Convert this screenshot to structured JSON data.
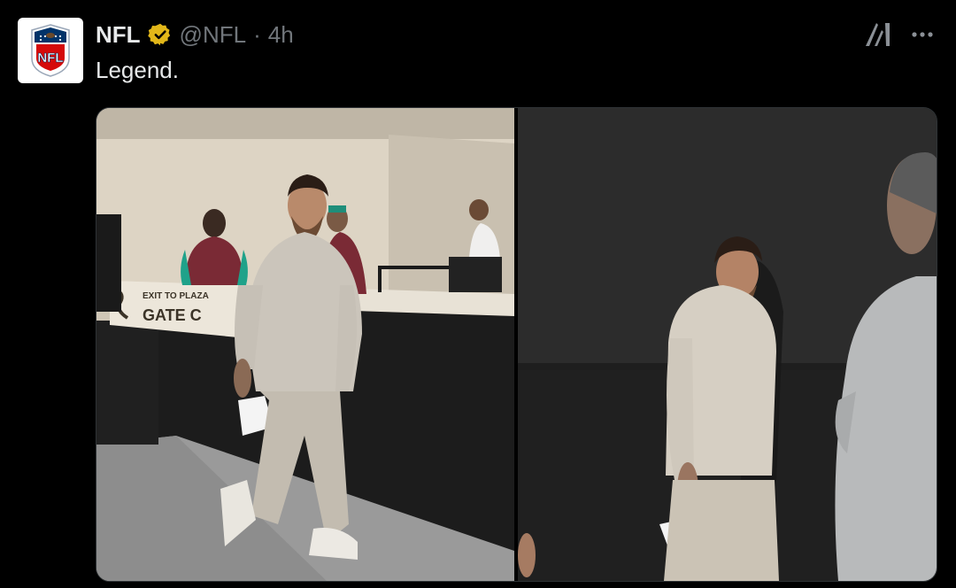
{
  "tweet": {
    "author_name": "NFL",
    "handle": "@NFL",
    "separator": "·",
    "time": "4h",
    "text": "Legend.",
    "verified_badge_color": "#e2b719"
  },
  "logo": {
    "text": "NFL",
    "colors": {
      "blue": "#013369",
      "red": "#d50a0a"
    }
  },
  "icons": {
    "grok": "grok-icon",
    "more": "more-options-icon",
    "verified": "verified-badge-icon"
  },
  "media": {
    "count": 2,
    "left_photo": {
      "sign_line1": "EXIT TO PLAZA",
      "sign_line2": "GATE C"
    }
  }
}
